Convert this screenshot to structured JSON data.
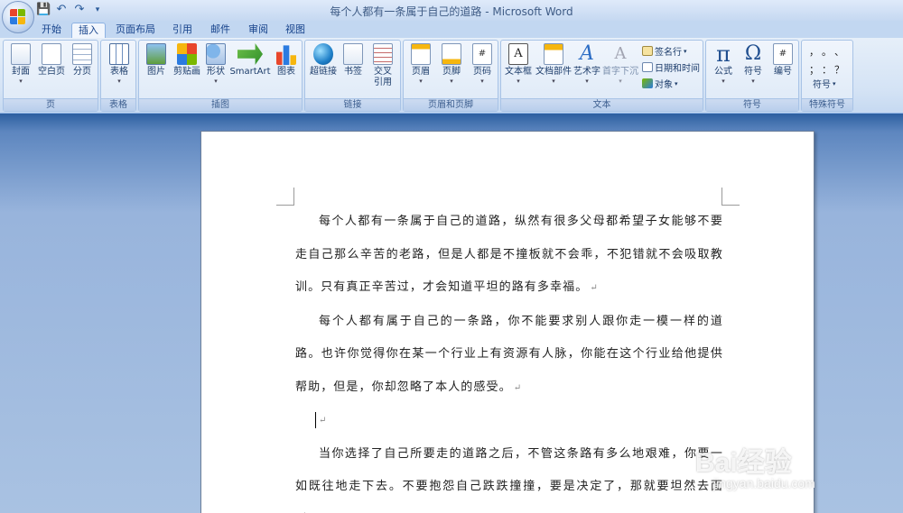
{
  "window": {
    "title": "每个人都有一条属于自己的道路 - Microsoft Word"
  },
  "qat": {
    "save_icon": "save-icon",
    "undo_icon": "undo-icon",
    "redo_icon": "redo-icon",
    "customize_icon": "qat-menu-icon"
  },
  "tabs": [
    {
      "label": "开始"
    },
    {
      "label": "插入",
      "active": true
    },
    {
      "label": "页面布局"
    },
    {
      "label": "引用"
    },
    {
      "label": "邮件"
    },
    {
      "label": "审阅"
    },
    {
      "label": "视图"
    }
  ],
  "ribbon": {
    "groups": {
      "pages": {
        "label": "页",
        "buttons": [
          "封面",
          "空白页",
          "分页"
        ]
      },
      "tables": {
        "label": "表格",
        "buttons": [
          "表格"
        ]
      },
      "illustrations": {
        "label": "插图",
        "buttons": [
          "图片",
          "剪贴画",
          "形状",
          "SmartArt",
          "图表"
        ]
      },
      "links": {
        "label": "链接",
        "buttons": [
          "超链接",
          "书签",
          "交叉",
          "引用"
        ]
      },
      "header_footer": {
        "label": "页眉和页脚",
        "buttons": [
          "页眉",
          "页脚",
          "页码"
        ]
      },
      "text": {
        "label": "文本",
        "buttons": [
          "文本框",
          "文档部件",
          "艺术字",
          "首字下沉"
        ],
        "small": [
          "签名行",
          "日期和时间",
          "对象"
        ]
      },
      "symbols": {
        "label": "符号",
        "buttons": [
          "公式",
          "符号",
          "编号"
        ]
      },
      "special": {
        "label": "特殊符号",
        "chars": [
          "，",
          "。",
          "、",
          "；",
          "：",
          "？"
        ],
        "small": "符号"
      }
    },
    "arrow": "▾"
  },
  "document": {
    "paragraphs": [
      "每个人都有一条属于自己的道路，纵然有很多父母都希望子女能够不要走自己那么辛苦的老路，但是人都是不撞板就不会乖，不犯错就不会吸取教训。只有真正辛苦过，才会知道平坦的路有多幸福。",
      "每个人都有属于自己的一条路，你不能要求别人跟你走一模一样的道路。也许你觉得你在某一个行业上有资源有人脉，你能在这个行业给他提供帮助，但是，你却忽略了本人的感受。",
      "当你选择了自己所要走的道路之后，不管这条路有多么地艰难，你要一如既往地走下去。不要抱怨自己跌跌撞撞，要是决定了，那就要坦然去面对。"
    ],
    "para_mark": "↵"
  },
  "watermark": {
    "text": "Bai经验",
    "url": "jingyan.baidu.com"
  },
  "colors": {
    "ribbon_bg": "#dbe7f6",
    "workspace": "#a9c2e2",
    "accent": "#15428b"
  }
}
